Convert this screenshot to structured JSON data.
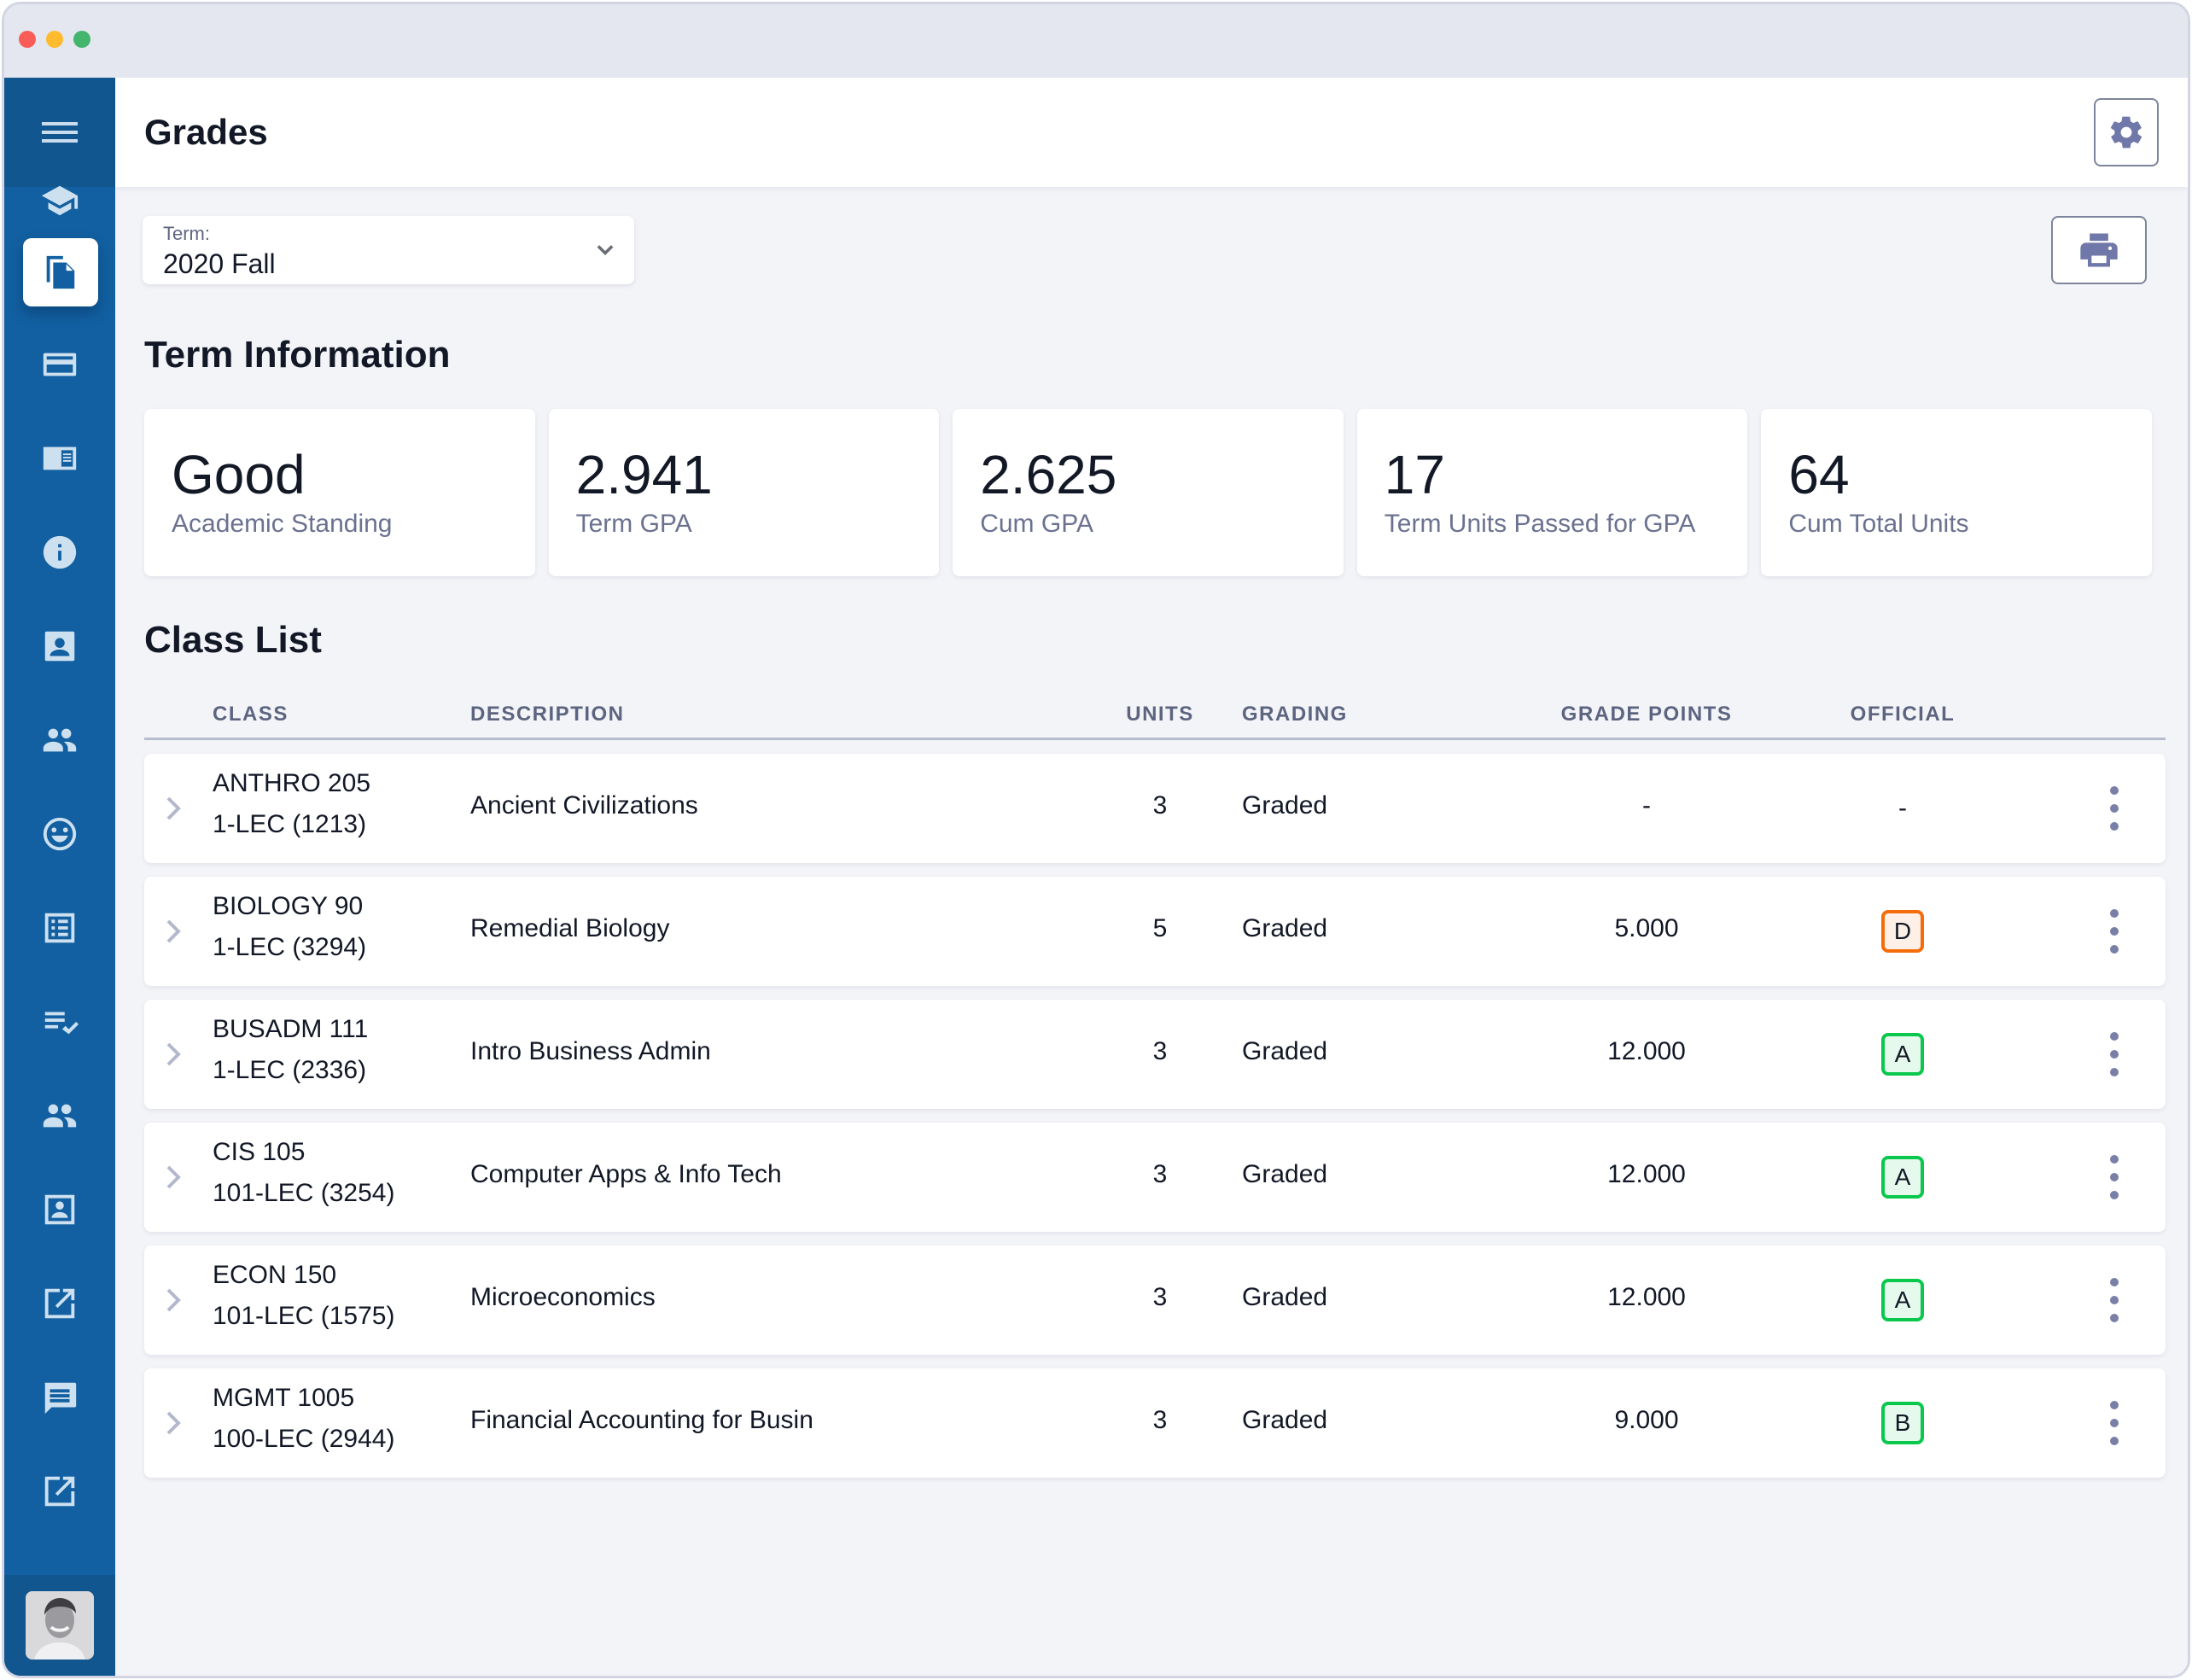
{
  "window": {
    "controls": [
      "close",
      "minimize",
      "maximize"
    ]
  },
  "sidebar": {
    "menu_icon": "hamburger-menu-icon",
    "items": [
      {
        "name": "graduation-cap-icon",
        "active": false
      },
      {
        "name": "documents-icon",
        "active": true
      },
      {
        "name": "credit-card-icon",
        "active": false
      },
      {
        "name": "catalog-icon",
        "active": false
      },
      {
        "name": "info-icon",
        "active": false
      },
      {
        "name": "contact-card-icon",
        "active": false
      },
      {
        "name": "people-icon",
        "active": false
      },
      {
        "name": "smiley-icon",
        "active": false
      },
      {
        "name": "list-icon",
        "active": false
      },
      {
        "name": "checklist-icon",
        "active": false
      },
      {
        "name": "group-icon",
        "active": false
      },
      {
        "name": "profile-frame-icon",
        "active": false
      },
      {
        "name": "external-link-icon",
        "active": false
      },
      {
        "name": "chat-icon",
        "active": false
      },
      {
        "name": "external-link-icon",
        "active": false
      }
    ],
    "avatar": "user-avatar"
  },
  "header": {
    "title": "Grades",
    "settings_icon": "gear-icon"
  },
  "term": {
    "label": "Term:",
    "value": "2020 Fall",
    "print_icon": "printer-icon"
  },
  "term_info": {
    "title": "Term Information",
    "cards": [
      {
        "value": "Good",
        "caption": "Academic Standing"
      },
      {
        "value": "2.941",
        "caption": "Term GPA"
      },
      {
        "value": "2.625",
        "caption": "Cum GPA"
      },
      {
        "value": "17",
        "caption": "Term Units Passed for GPA"
      },
      {
        "value": "64",
        "caption": "Cum Total Units"
      }
    ]
  },
  "class_list": {
    "title": "Class List",
    "columns": [
      "CLASS",
      "DESCRIPTION",
      "UNITS",
      "GRADING",
      "GRADE POINTS",
      "OFFICIAL"
    ],
    "rows": [
      {
        "class": "ANTHRO 205",
        "section": "1-LEC (1213)",
        "description": "Ancient Civilizations",
        "units": "3",
        "grading": "Graded",
        "grade_points": "-",
        "official": "-",
        "official_color": ""
      },
      {
        "class": "BIOLOGY 90",
        "section": "1-LEC (3294)",
        "description": "Remedial Biology",
        "units": "5",
        "grading": "Graded",
        "grade_points": "5.000",
        "official": "D",
        "official_color": "#f56d0a"
      },
      {
        "class": "BUSADM 111",
        "section": "1-LEC (2336)",
        "description": "Intro Business Admin",
        "units": "3",
        "grading": "Graded",
        "grade_points": "12.000",
        "official": "A",
        "official_color": "#0ac84c"
      },
      {
        "class": "CIS 105",
        "section": "101-LEC (3254)",
        "description": "Computer Apps & Info Tech",
        "units": "3",
        "grading": "Graded",
        "grade_points": "12.000",
        "official": "A",
        "official_color": "#0ac84c"
      },
      {
        "class": "ECON 150",
        "section": "101-LEC (1575)",
        "description": "Microeconomics",
        "units": "3",
        "grading": "Graded",
        "grade_points": "12.000",
        "official": "A",
        "official_color": "#0ac84c"
      },
      {
        "class": "MGMT 1005",
        "section": "100-LEC (2944)",
        "description": "Financial Accounting for Busin",
        "units": "3",
        "grading": "Graded",
        "grade_points": "9.000",
        "official": "B",
        "official_color": "#0ac84c"
      }
    ]
  },
  "colors": {
    "sidebar": "#1260a1",
    "sidebar_dark": "#11568f",
    "background": "#f3f4f8",
    "grade_warning": "#f56d0a",
    "grade_success": "#0ac84c",
    "icon_accent": "#6f78a8"
  }
}
